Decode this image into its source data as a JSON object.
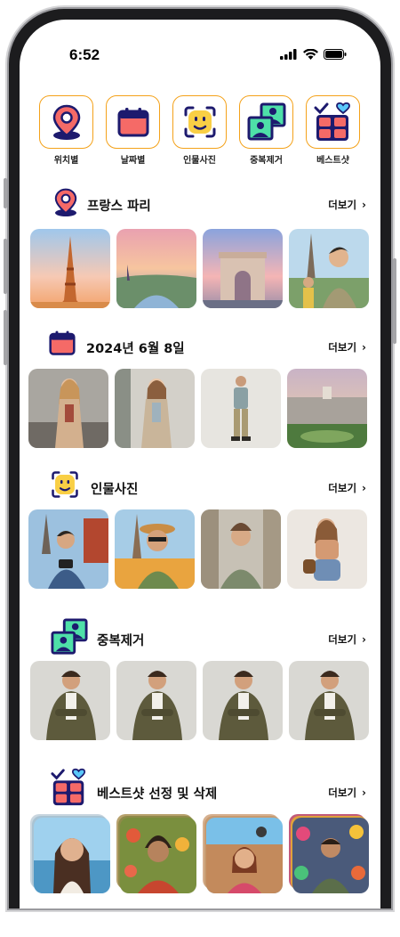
{
  "status_bar": {
    "time": "6:52"
  },
  "categories": [
    {
      "label": "위치별",
      "icon": "location-pin-icon"
    },
    {
      "label": "날짜별",
      "icon": "calendar-icon"
    },
    {
      "label": "인물사진",
      "icon": "face-scan-icon"
    },
    {
      "label": "중복제거",
      "icon": "duplicate-photos-icon"
    },
    {
      "label": "베스트샷",
      "icon": "best-shot-grid-icon"
    }
  ],
  "sections": [
    {
      "title": "프랑스 파리",
      "more": "더보기",
      "icon": "location-pin-icon"
    },
    {
      "title": "2024년 6월 8일",
      "more": "더보기",
      "icon": "calendar-icon"
    },
    {
      "title": "인물사진",
      "more": "더보기",
      "icon": "face-scan-icon"
    },
    {
      "title": "중복제거",
      "more": "더보기",
      "icon": "duplicate-photos-icon"
    },
    {
      "title": "베스트샷 선정 및 삭제",
      "more": "더보기",
      "icon": "best-shot-grid-icon"
    }
  ],
  "colors": {
    "accent_orange": "#f4a21a",
    "navy": "#1d1a6e",
    "coral": "#f56a67",
    "yellow": "#f9cf45",
    "mint": "#4ee0a8",
    "heart_blue": "#5ac8fa"
  }
}
